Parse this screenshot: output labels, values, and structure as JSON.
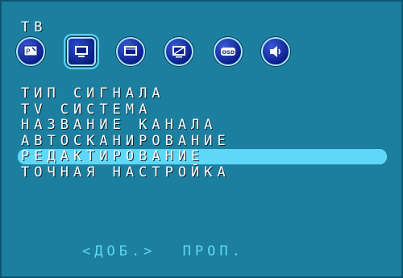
{
  "header": {
    "title": "ТВ"
  },
  "icons": [
    {
      "name": "picture-icon"
    },
    {
      "name": "tv-icon",
      "selected": true
    },
    {
      "name": "monitor-icon"
    },
    {
      "name": "screen-adjust-icon"
    },
    {
      "name": "osd-icon",
      "text": "OSD"
    },
    {
      "name": "speaker-icon"
    }
  ],
  "menu": {
    "items": [
      {
        "label": "ТИП СИГНАЛА"
      },
      {
        "label": "TV СИСТЕМА"
      },
      {
        "label": "НАЗВАНИЕ КАНАЛА"
      },
      {
        "label": "АВТОСКАНИРОВАНИЕ"
      },
      {
        "label": "РЕДАКТИРОВАНИЕ",
        "selected": true
      },
      {
        "label": "ТОЧНАЯ НАСТРОЙКА"
      }
    ]
  },
  "footer": {
    "add_label": "<ДОБ.>",
    "skip_label": "ПРОП."
  },
  "colors": {
    "background": "#1d7fa0",
    "highlight": "#5fd8f7",
    "icon_fill": "#0b1f8a"
  }
}
